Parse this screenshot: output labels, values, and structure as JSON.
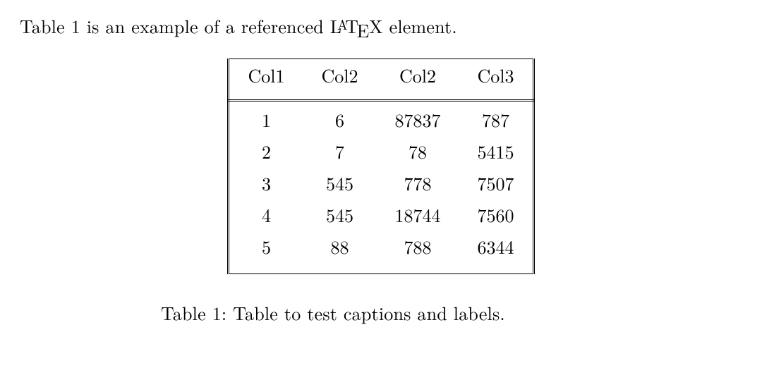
{
  "intro": {
    "text_before": "Table 1 is an example of a referenced ",
    "latex_word": "LATEX",
    "text_after": " element."
  },
  "chart_data": {
    "type": "table",
    "headers": [
      "Col1",
      "Col2",
      "Col2",
      "Col3"
    ],
    "rows": [
      [
        1,
        6,
        87837,
        787
      ],
      [
        2,
        7,
        78,
        5415
      ],
      [
        3,
        545,
        778,
        7507
      ],
      [
        4,
        545,
        18744,
        7560
      ],
      [
        5,
        88,
        788,
        6344
      ]
    ]
  },
  "caption": {
    "label": "Table 1:",
    "text": "Table to test captions and labels."
  }
}
